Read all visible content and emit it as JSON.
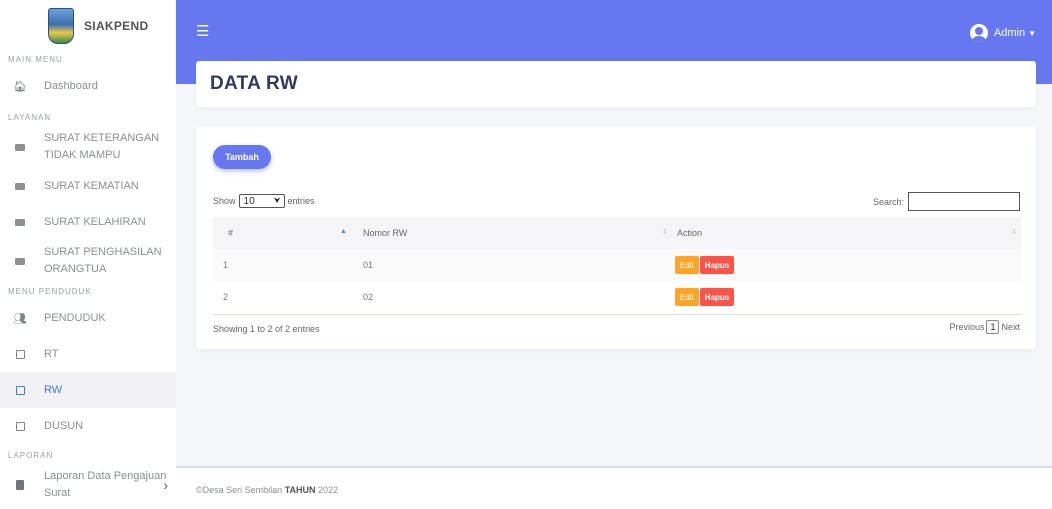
{
  "brand": {
    "name": "SIAKPEND"
  },
  "sidebar": {
    "sections": [
      {
        "label": "MAIN MENU"
      },
      {
        "label": "LAYANAN"
      },
      {
        "label": "MENU PENDUDUK"
      },
      {
        "label": "LAPORAN"
      }
    ],
    "items": [
      {
        "label": "Dashboard",
        "icon": "home-icon"
      },
      {
        "label": "SURAT KETERANGAN TIDAK MAMPU",
        "line1": "SURAT KETERANGAN",
        "line2": "TIDAK MAMPU",
        "icon": "envelope-icon"
      },
      {
        "label": "SURAT KEMATIAN",
        "icon": "envelope-icon"
      },
      {
        "label": "SURAT KELAHIRAN",
        "icon": "envelope-icon"
      },
      {
        "label": "SURAT PENGHASILAN ORANGTUA",
        "line1": "SURAT PENGHASILAN",
        "line2": "ORANGTUA",
        "icon": "envelope-icon"
      },
      {
        "label": "PENDUDUK",
        "icon": "users-icon"
      },
      {
        "label": "RT",
        "icon": "square-icon"
      },
      {
        "label": "RW",
        "icon": "square-icon",
        "active": true
      },
      {
        "label": "DUSUN",
        "icon": "square-icon"
      },
      {
        "label": "Laporan Data Pengajuan Surat",
        "line1": "Laporan Data Pengajuan",
        "line2": "Surat",
        "icon": "document-icon"
      }
    ]
  },
  "topbar": {
    "user_name": "Admin"
  },
  "page": {
    "title": "DATA RW"
  },
  "table_controls": {
    "add_label": "Tambah",
    "show_label": "Show",
    "page_length": "10",
    "entries_label": "entries",
    "search_label": "Search:"
  },
  "table": {
    "columns": [
      "#",
      "Nomor RW",
      "Action"
    ],
    "rows": [
      {
        "no": "1",
        "nomor_rw": "01",
        "edit": "Edit",
        "delete": "Hapus"
      },
      {
        "no": "2",
        "nomor_rw": "02",
        "edit": "Edit",
        "delete": "Hapus"
      }
    ],
    "info": "Showing 1 to 2 of 2 entries",
    "previous": "Previous",
    "current_page": "1",
    "next": "Next"
  },
  "footer": {
    "prefix": "©Desa Seri Sembilan",
    "bold": "TAHUN",
    "year": "2022"
  },
  "colors": {
    "primary": "#6777ef",
    "warning": "#ffa426",
    "danger": "#fc544b"
  }
}
